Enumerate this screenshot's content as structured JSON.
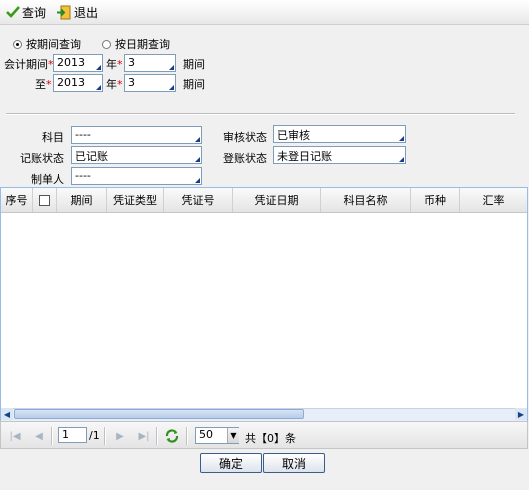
{
  "toolbar": {
    "query_label": "查询",
    "exit_label": "退出"
  },
  "mode": {
    "by_period_label": "按期间查询",
    "by_date_label": "按日期查询",
    "selected": "by_period"
  },
  "period": {
    "from_label": "会计期间",
    "to_label": "至",
    "year_unit": "年",
    "period_unit": "期间",
    "from_year": "2013",
    "from_period": "3",
    "to_year": "2013",
    "to_period": "3"
  },
  "filters": {
    "subject_label": "科目",
    "subject_value": "----",
    "audit_label": "审核状态",
    "audit_value": "已审核",
    "post_label": "记账状态",
    "post_value": "已记账",
    "daybook_label": "登账状态",
    "daybook_value": "未登日记账",
    "maker_label": "制单人",
    "maker_value": "----"
  },
  "grid": {
    "columns": [
      "序号",
      "",
      "期间",
      "凭证类型",
      "凭证号",
      "凭证日期",
      "科目名称",
      "币种",
      "汇率"
    ]
  },
  "pager": {
    "page": "1",
    "total_pages": "/1",
    "page_size": "50",
    "total_text": "共【0】条"
  },
  "actions": {
    "ok_label": "确定",
    "cancel_label": "取消"
  },
  "colors": {
    "accent": "#1a3b8c",
    "border": "#99bbe8"
  }
}
